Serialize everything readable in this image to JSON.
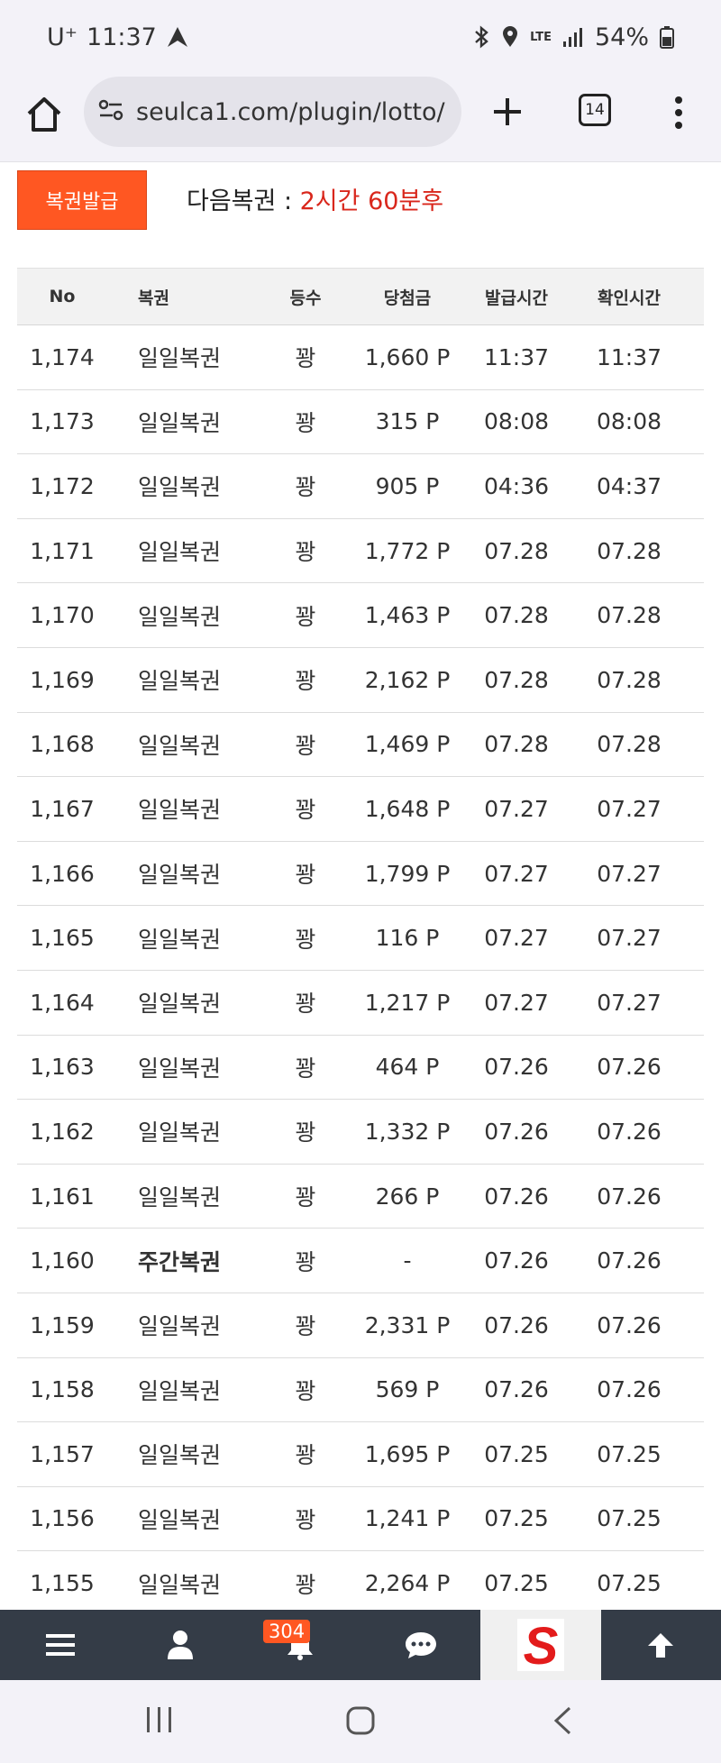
{
  "status_bar": {
    "carrier": "U⁺",
    "time": "11:37",
    "battery": "54%",
    "network": "LTE"
  },
  "browser": {
    "url": "seulca1.com/plugin/lotto/",
    "tab_count": "14"
  },
  "topbar": {
    "issue_button": "복권발급",
    "next_label": "다음복권 : ",
    "next_value": "2시간 60분후"
  },
  "table": {
    "headers": [
      "No",
      "복권",
      "등수",
      "당첨금",
      "발급시간",
      "확인시간"
    ],
    "rows": [
      {
        "no": "1,174",
        "name": "일일복권",
        "rank": "꽝",
        "amount": "1,660 P",
        "issued": "11:37",
        "checked": "11:37"
      },
      {
        "no": "1,173",
        "name": "일일복권",
        "rank": "꽝",
        "amount": "315 P",
        "issued": "08:08",
        "checked": "08:08"
      },
      {
        "no": "1,172",
        "name": "일일복권",
        "rank": "꽝",
        "amount": "905 P",
        "issued": "04:36",
        "checked": "04:37"
      },
      {
        "no": "1,171",
        "name": "일일복권",
        "rank": "꽝",
        "amount": "1,772 P",
        "issued": "07.28",
        "checked": "07.28"
      },
      {
        "no": "1,170",
        "name": "일일복권",
        "rank": "꽝",
        "amount": "1,463 P",
        "issued": "07.28",
        "checked": "07.28"
      },
      {
        "no": "1,169",
        "name": "일일복권",
        "rank": "꽝",
        "amount": "2,162 P",
        "issued": "07.28",
        "checked": "07.28"
      },
      {
        "no": "1,168",
        "name": "일일복권",
        "rank": "꽝",
        "amount": "1,469 P",
        "issued": "07.28",
        "checked": "07.28"
      },
      {
        "no": "1,167",
        "name": "일일복권",
        "rank": "꽝",
        "amount": "1,648 P",
        "issued": "07.27",
        "checked": "07.27"
      },
      {
        "no": "1,166",
        "name": "일일복권",
        "rank": "꽝",
        "amount": "1,799 P",
        "issued": "07.27",
        "checked": "07.27"
      },
      {
        "no": "1,165",
        "name": "일일복권",
        "rank": "꽝",
        "amount": "116 P",
        "issued": "07.27",
        "checked": "07.27"
      },
      {
        "no": "1,164",
        "name": "일일복권",
        "rank": "꽝",
        "amount": "1,217 P",
        "issued": "07.27",
        "checked": "07.27"
      },
      {
        "no": "1,163",
        "name": "일일복권",
        "rank": "꽝",
        "amount": "464 P",
        "issued": "07.26",
        "checked": "07.26"
      },
      {
        "no": "1,162",
        "name": "일일복권",
        "rank": "꽝",
        "amount": "1,332 P",
        "issued": "07.26",
        "checked": "07.26"
      },
      {
        "no": "1,161",
        "name": "일일복권",
        "rank": "꽝",
        "amount": "266 P",
        "issued": "07.26",
        "checked": "07.26"
      },
      {
        "no": "1,160",
        "name": "주간복권",
        "rank": "꽝",
        "amount": "-",
        "issued": "07.26",
        "checked": "07.26",
        "bold": true
      },
      {
        "no": "1,159",
        "name": "일일복권",
        "rank": "꽝",
        "amount": "2,331 P",
        "issued": "07.26",
        "checked": "07.26"
      },
      {
        "no": "1,158",
        "name": "일일복권",
        "rank": "꽝",
        "amount": "569 P",
        "issued": "07.26",
        "checked": "07.26"
      },
      {
        "no": "1,157",
        "name": "일일복권",
        "rank": "꽝",
        "amount": "1,695 P",
        "issued": "07.25",
        "checked": "07.25"
      },
      {
        "no": "1,156",
        "name": "일일복권",
        "rank": "꽝",
        "amount": "1,241 P",
        "issued": "07.25",
        "checked": "07.25"
      },
      {
        "no": "1,155",
        "name": "일일복권",
        "rank": "꽝",
        "amount": "2,264 P",
        "issued": "07.25",
        "checked": "07.25"
      }
    ]
  },
  "bottom_nav": {
    "notification_count": "304",
    "logo_letter": "S"
  },
  "colors": {
    "accent": "#ff5722",
    "highlight_red": "#d9271c",
    "nav_bg": "#343c47"
  }
}
